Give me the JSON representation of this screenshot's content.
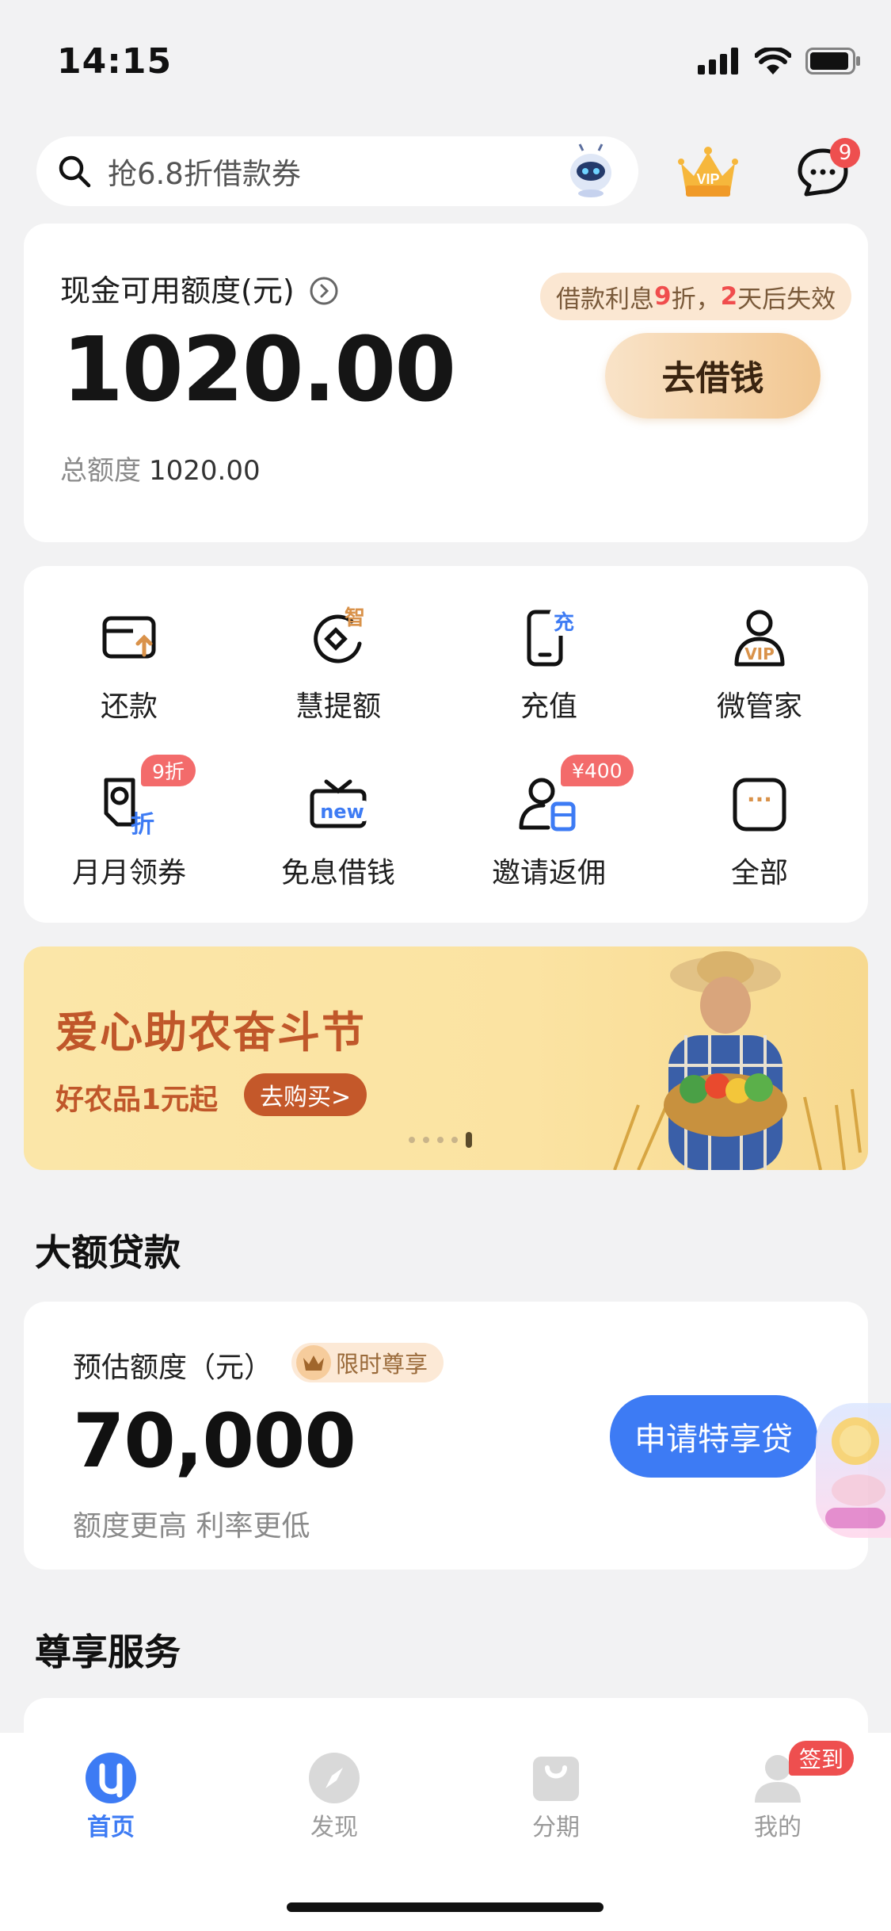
{
  "status_bar": {
    "time": "14:15"
  },
  "search": {
    "placeholder": "抢6.8折借款券"
  },
  "header": {
    "vip_label": "VIP",
    "message_badge": "9"
  },
  "cash_card": {
    "title": "现金可用额度(元)",
    "amount": "1020.00",
    "total_label": "总额度",
    "total_value": "1020.00",
    "promo_prefix": "借款利息",
    "promo_discount": "9",
    "promo_mid": "折，",
    "promo_days": "2",
    "promo_suffix": "天后失效",
    "button": "去借钱"
  },
  "shortcuts": [
    {
      "label": "还款"
    },
    {
      "label": "慧提额",
      "icon_text": "智"
    },
    {
      "label": "充值",
      "icon_text": "充"
    },
    {
      "label": "微管家",
      "icon_text": "VIP"
    },
    {
      "label": "月月领券",
      "badge": "9折",
      "icon_text": "折"
    },
    {
      "label": "免息借钱",
      "icon_text": "new"
    },
    {
      "label": "邀请返佣",
      "badge": "¥400"
    },
    {
      "label": "全部",
      "icon_text": "···"
    }
  ],
  "banner": {
    "title": "爱心助农奋斗节",
    "subtitle": "好农品1元起",
    "button": "去购买>",
    "page_count": 5,
    "active_page": 5
  },
  "big_loan": {
    "section_title": "大额贷款",
    "label": "预估额度（元）",
    "tag": "限时尊享",
    "amount": "70,000",
    "desc": "额度更高 利率更低",
    "button": "申请特享贷"
  },
  "vip_service": {
    "section_title": "尊享服务"
  },
  "tabbar": {
    "items": [
      {
        "label": "首页",
        "active": true
      },
      {
        "label": "发现",
        "active": false
      },
      {
        "label": "分期",
        "active": false
      },
      {
        "label": "我的",
        "active": false,
        "badge": "签到"
      }
    ]
  },
  "colors": {
    "accent_blue": "#3d7bf4",
    "badge_red": "#ee4f4f",
    "banner_brown": "#c0572a"
  }
}
